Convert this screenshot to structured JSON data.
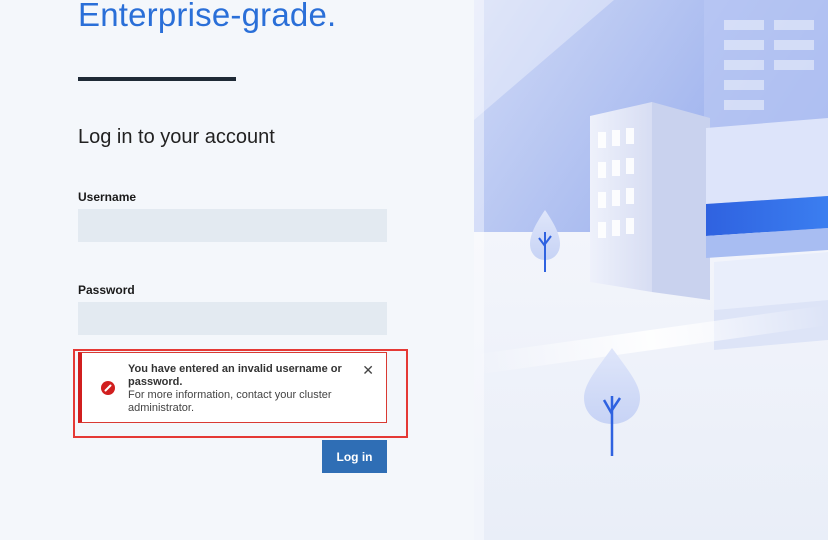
{
  "hero": {
    "tagline": "Enterprise-grade."
  },
  "form": {
    "heading": "Log in to your account",
    "username_label": "Username",
    "username_value": "",
    "password_label": "Password",
    "password_value": "",
    "submit_label": "Log in"
  },
  "alert": {
    "title": "You have entered an invalid username or password.",
    "message": "For more information, contact your cluster administrator.",
    "close_glyph": "✕",
    "icon": "error-icon"
  },
  "colors": {
    "accent": "#2a6fd8",
    "button": "#2f6eb5",
    "error": "#d11f1f",
    "highlight": "#e53935"
  }
}
